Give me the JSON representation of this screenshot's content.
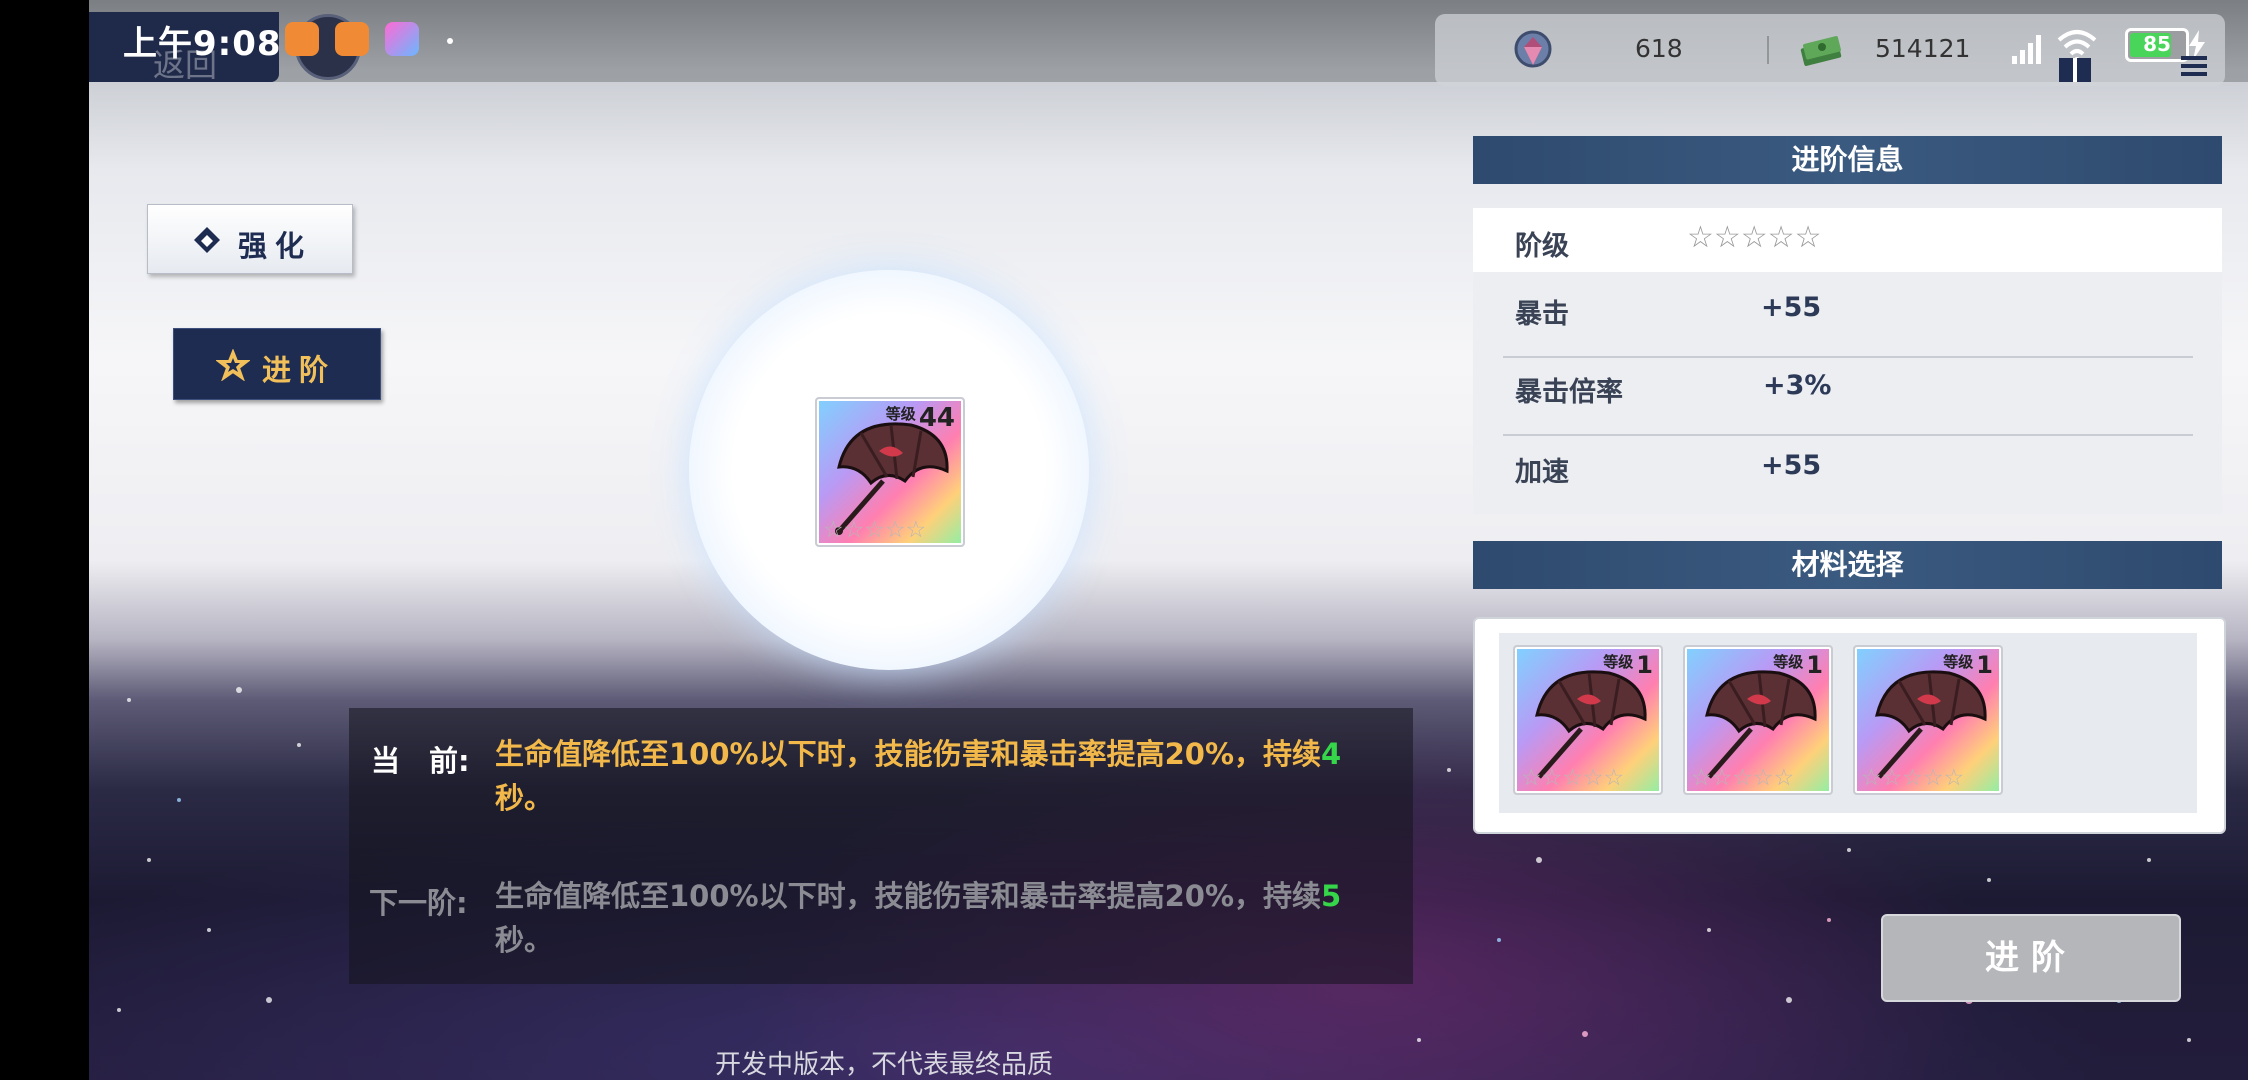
{
  "status_bar": {
    "time": "上午9:08",
    "back_label": "返回"
  },
  "resources": {
    "crystal": "618",
    "money": "514121",
    "battery": "85"
  },
  "tabs": {
    "enhance_label": "强化",
    "advance_label": "进阶"
  },
  "item": {
    "level_word": "等级",
    "level": "44",
    "stars": "☆☆☆☆☆"
  },
  "advance_info": {
    "header": "进阶信息",
    "rows": [
      {
        "label": "阶级",
        "value": "☆☆☆☆☆"
      },
      {
        "label": "暴击",
        "value": "+55"
      },
      {
        "label": "暴击倍率",
        "value": "+3%"
      },
      {
        "label": "加速",
        "value": "+55"
      }
    ]
  },
  "materials": {
    "header": "材料选择",
    "items": [
      {
        "level_word": "等级",
        "level": "1",
        "stars": "☆☆☆☆☆"
      },
      {
        "level_word": "等级",
        "level": "1",
        "stars": "☆☆☆☆☆"
      },
      {
        "level_word": "等级",
        "level": "1",
        "stars": "☆☆☆☆☆"
      }
    ]
  },
  "description": {
    "current_label": "当　前:",
    "current_text_before": "生命值降低至100%以下时，技能伤害和暴击率提高20%，持续",
    "current_duration": "4",
    "current_text_after": "秒。",
    "next_label": "下一阶:",
    "next_text_before": "生命值降低至100%以下时，技能伤害和暴击率提高20%，持续",
    "next_duration": "5",
    "next_text_after": "秒。"
  },
  "advance_button": "进阶",
  "footer_note": "开发中版本，不代表最终品质",
  "colors": {
    "current_text": "#f2b94a",
    "next_text": "#8b8c93",
    "duration_highlight": "#35d64a",
    "panel_header": "#2e4a6e"
  }
}
